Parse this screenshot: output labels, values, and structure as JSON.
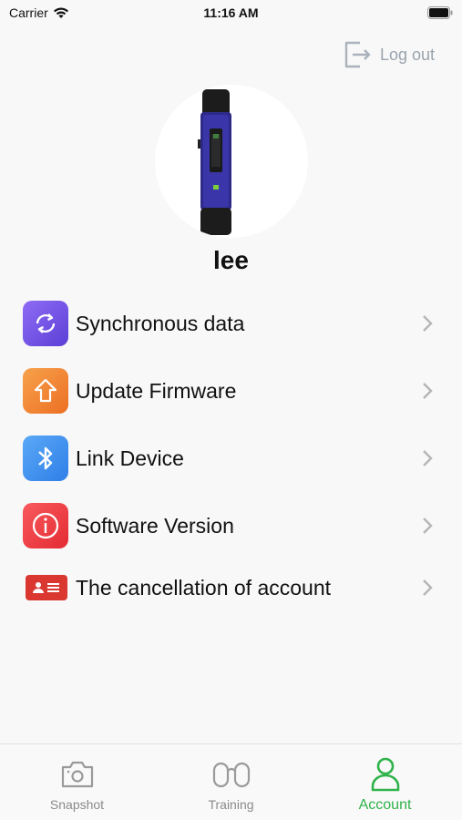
{
  "status_bar": {
    "carrier": "Carrier",
    "time": "11:16 AM"
  },
  "header": {
    "logout_label": "Log out"
  },
  "profile": {
    "username": "lee"
  },
  "menu": {
    "items": [
      {
        "label": "Synchronous data",
        "icon": "sync-icon",
        "color": "#7b5cf0"
      },
      {
        "label": "Update Firmware",
        "icon": "upload-arrow-icon",
        "color": "#f08a3a"
      },
      {
        "label": "Link Device",
        "icon": "bluetooth-icon",
        "color": "#3d8ff0"
      },
      {
        "label": "Software Version",
        "icon": "info-icon",
        "color": "#f03a3f"
      },
      {
        "label": "The cancellation of account",
        "icon": "id-card-icon",
        "color": "#d9372f"
      }
    ]
  },
  "tabbar": {
    "tabs": [
      {
        "label": "Snapshot",
        "icon": "camera-icon"
      },
      {
        "label": "Training",
        "icon": "binoculars-icon"
      },
      {
        "label": "Account",
        "icon": "person-icon"
      }
    ],
    "active": "Account",
    "active_color": "#2fb34a"
  }
}
